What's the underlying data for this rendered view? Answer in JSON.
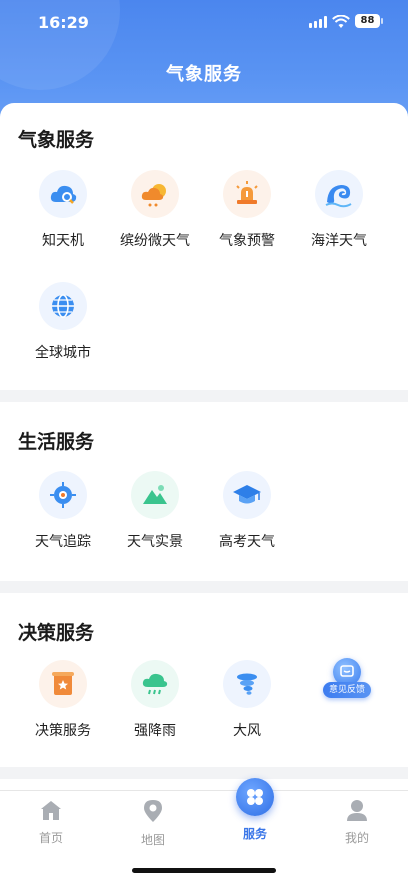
{
  "status_bar": {
    "time": "16:29",
    "battery": "88"
  },
  "header": {
    "title": "气象服务"
  },
  "sections": [
    {
      "title": "气象服务",
      "items": [
        {
          "label": "知天机",
          "icon": "cloud-search-icon"
        },
        {
          "label": "缤纷微天气",
          "icon": "sun-cloud-icon"
        },
        {
          "label": "气象预警",
          "icon": "alarm-icon"
        },
        {
          "label": "海洋天气",
          "icon": "wave-icon"
        },
        {
          "label": "全球城市",
          "icon": "globe-icon"
        }
      ]
    },
    {
      "title": "生活服务",
      "items": [
        {
          "label": "天气追踪",
          "icon": "target-icon"
        },
        {
          "label": "天气实景",
          "icon": "mountain-icon"
        },
        {
          "label": "高考天气",
          "icon": "graduation-cap-icon"
        }
      ]
    },
    {
      "title": "决策服务",
      "items": [
        {
          "label": "决策服务",
          "icon": "scroll-star-icon"
        },
        {
          "label": "强降雨",
          "icon": "rain-cloud-icon"
        },
        {
          "label": "大风",
          "icon": "wind-icon"
        }
      ]
    }
  ],
  "feedback": {
    "label": "意见反馈"
  },
  "tabbar": {
    "tabs": [
      {
        "label": "首页",
        "icon": "home-icon"
      },
      {
        "label": "地图",
        "icon": "map-pin-icon"
      },
      {
        "label": "服务",
        "icon": "grid-icon"
      },
      {
        "label": "我的",
        "icon": "user-icon"
      }
    ],
    "active": "服务"
  },
  "colors": {
    "accent": "#3a76e8",
    "header_top": "#4b86ee",
    "orange": "#f59a3a",
    "green": "#3ac48e"
  }
}
